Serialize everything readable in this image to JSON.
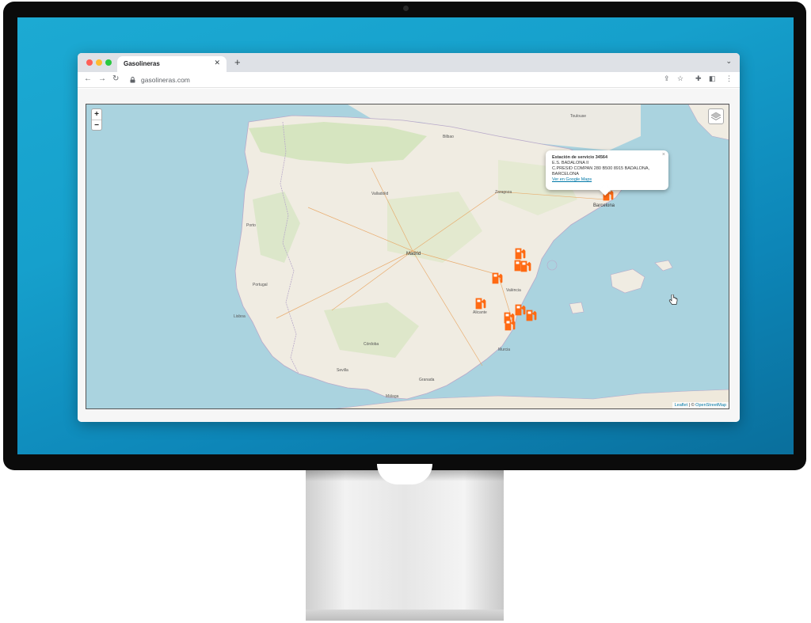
{
  "browser": {
    "tab_title": "Gasolineras",
    "url": "gasolineras.com"
  },
  "map": {
    "zoom_in": "+",
    "zoom_out": "−",
    "attribution_leaflet": "Leaflet",
    "attribution_osm": "OpenStreetMap",
    "popup": {
      "title": "Estación de servicio 34564",
      "name": "E.S. BADALONA II",
      "address": "C.PRESID COMPAN 280 B500  8915 BADALONA,",
      "province": "BARCELONA",
      "link": "Ver en Google Maps",
      "close": "×"
    },
    "cities": {
      "madrid": "Madrid",
      "barcelona": "Barcelona",
      "zaragoza": "Zaragoza",
      "valencia": "València",
      "sevilla": "Sevilla",
      "lisboa": "Lisboa",
      "porto": "Porto",
      "murcia": "Murcia",
      "malaga": "Málaga",
      "bilbao": "Bilbao",
      "toulouse": "Toulouse",
      "alicante": "Alicante",
      "granada": "Granada",
      "cordoba": "Córdoba",
      "valladolid": "Valladolid",
      "portugal": "Portugal"
    }
  }
}
